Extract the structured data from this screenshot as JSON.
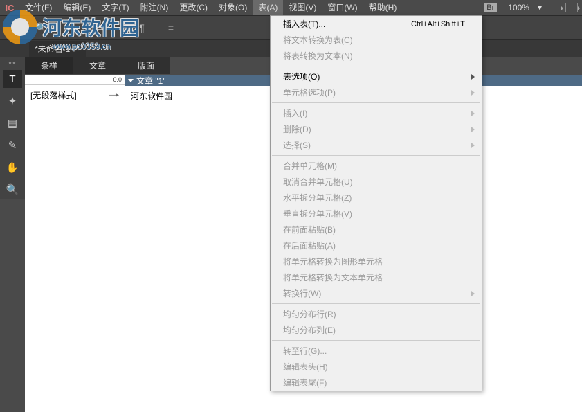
{
  "app_icon": "IC",
  "menubar": [
    "文件(F)",
    "编辑(E)",
    "文字(T)",
    "附注(N)",
    "更改(C)",
    "对象(O)",
    "表(A)",
    "视图(V)",
    "窗口(W)",
    "帮助(H)"
  ],
  "menubar_active_index": 6,
  "br_label": "Br",
  "zoom": "100%",
  "watermark_text": "河东软件园",
  "watermark_url": "www.pc0359.cn",
  "doc_tab": "*未命名-1",
  "panel_tabs": [
    "条样",
    "文章",
    "版面"
  ],
  "ruler_value": "0.0",
  "left_list_item": "[无段落样式]",
  "article_header": "文章 \"1\"",
  "article_body": "河东软件园",
  "dropdown": {
    "groups": [
      [
        {
          "label": "插入表(T)...",
          "shortcut": "Ctrl+Alt+Shift+T",
          "enabled": true
        },
        {
          "label": "将文本转换为表(C)",
          "enabled": false
        },
        {
          "label": "将表转换为文本(N)",
          "enabled": false
        }
      ],
      [
        {
          "label": "表选项(O)",
          "enabled": true,
          "submenu": true
        },
        {
          "label": "单元格选项(P)",
          "enabled": false,
          "submenu": true
        }
      ],
      [
        {
          "label": "插入(I)",
          "enabled": false,
          "submenu": true
        },
        {
          "label": "删除(D)",
          "enabled": false,
          "submenu": true
        },
        {
          "label": "选择(S)",
          "enabled": false,
          "submenu": true
        }
      ],
      [
        {
          "label": "合并单元格(M)",
          "enabled": false
        },
        {
          "label": "取消合并单元格(U)",
          "enabled": false
        },
        {
          "label": "水平拆分单元格(Z)",
          "enabled": false
        },
        {
          "label": "垂直拆分单元格(V)",
          "enabled": false
        },
        {
          "label": "在前面粘贴(B)",
          "enabled": false
        },
        {
          "label": "在后面粘贴(A)",
          "enabled": false
        },
        {
          "label": "将单元格转换为图形单元格",
          "enabled": false
        },
        {
          "label": "将单元格转换为文本单元格",
          "enabled": false
        },
        {
          "label": "转换行(W)",
          "enabled": false,
          "submenu": true
        }
      ],
      [
        {
          "label": "均匀分布行(R)",
          "enabled": false
        },
        {
          "label": "均匀分布列(E)",
          "enabled": false
        }
      ],
      [
        {
          "label": "转至行(G)...",
          "enabled": false
        },
        {
          "label": "编辑表头(H)",
          "enabled": false
        },
        {
          "label": "编辑表尾(F)",
          "enabled": false
        }
      ]
    ]
  }
}
